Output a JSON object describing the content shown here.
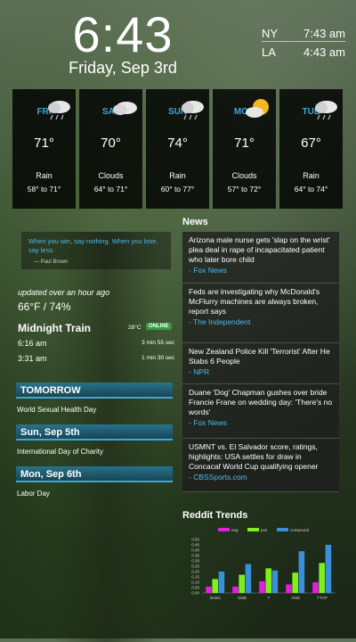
{
  "clock": {
    "time": "6:43",
    "date": "Friday, Sep 3rd"
  },
  "world_clocks": [
    {
      "city": "NY",
      "time": "7:43 am"
    },
    {
      "city": "LA",
      "time": "4:43 am"
    }
  ],
  "forecast": [
    {
      "day": "FRI",
      "icon": "rain-cloud-icon",
      "temp": "71°",
      "condition": "Rain",
      "range": "58° to 71°"
    },
    {
      "day": "SAT",
      "icon": "cloud-icon",
      "temp": "70°",
      "condition": "Clouds",
      "range": "64° to 71°"
    },
    {
      "day": "SUN",
      "icon": "rain-cloud-icon",
      "temp": "74°",
      "condition": "Rain",
      "range": "60° to 77°"
    },
    {
      "day": "MON",
      "icon": "partly-cloudy-icon",
      "temp": "71°",
      "condition": "Clouds",
      "range": "57° to 72°"
    },
    {
      "day": "TUE",
      "icon": "rain-cloud-icon",
      "temp": "67°",
      "condition": "Rain",
      "range": "64° to 74°"
    }
  ],
  "quote": {
    "text": "When you win, say nothing. When you lose, say less.",
    "author": "— Paul Brown"
  },
  "indoor": {
    "updated": "updated over an hour ago",
    "reading": "66°F / 74%"
  },
  "train": {
    "title": "Midnight Train",
    "temp": "28°C",
    "status": "ONLINE",
    "rows": [
      {
        "time": "6:16 am",
        "duration": "3 min 55 sec"
      },
      {
        "time": "3:31 am",
        "duration": "1 min 30 sec"
      }
    ]
  },
  "events": [
    {
      "heading": "TOMORROW",
      "text": "World Sexual Health Day"
    },
    {
      "heading": "Sun, Sep 5th",
      "text": "International Day of Charity"
    },
    {
      "heading": "Mon, Sep 6th",
      "text": "Labor Day"
    }
  ],
  "news": {
    "title": "News",
    "items": [
      {
        "headline": "Arizona male nurse gets 'slap on the wrist' plea deal in rape of incapacitated patient who later bore child",
        "source": "- Fox News"
      },
      {
        "headline": "Feds are investigating why McDonald's McFlurry machines are always broken, report says",
        "source": "- The Independent"
      },
      {
        "headline": "New Zealand Police Kill 'Terrorist' After He Stabs 6 People",
        "source": "- NPR"
      },
      {
        "headline": "Duane 'Dog' Chapman gushes over bride Francie Frane on wedding day: 'There's no words'",
        "source": "- Fox News"
      },
      {
        "headline": "USMNT vs. El Salvador score, ratings, highlights: USA settles for draw in Concacaf World Cup qualifying opener",
        "source": "- CBSSports.com"
      }
    ]
  },
  "reddit": {
    "title": "Reddit Trends",
    "colors": {
      "neg": "#e020e0",
      "pos": "#7ef01c",
      "compound": "#3a8fd8"
    }
  },
  "chart_data": {
    "type": "bar",
    "categories": [
      "BABA",
      "GME",
      "T",
      "AMD",
      "TTCP"
    ],
    "series": [
      {
        "name": "neg",
        "values": [
          0.06,
          0.06,
          0.11,
          0.08,
          0.1
        ]
      },
      {
        "name": "pos",
        "values": [
          0.13,
          0.17,
          0.23,
          0.19,
          0.28
        ]
      },
      {
        "name": "compound",
        "values": [
          0.2,
          0.27,
          0.21,
          0.39,
          0.45
        ]
      }
    ],
    "yticks": [
      "0.50",
      "0.45",
      "0.40",
      "0.35",
      "0.30",
      "0.25",
      "0.20",
      "0.15",
      "0.10",
      "0.05",
      "0.00"
    ],
    "ylim": [
      0,
      0.5
    ],
    "legend": "top"
  }
}
